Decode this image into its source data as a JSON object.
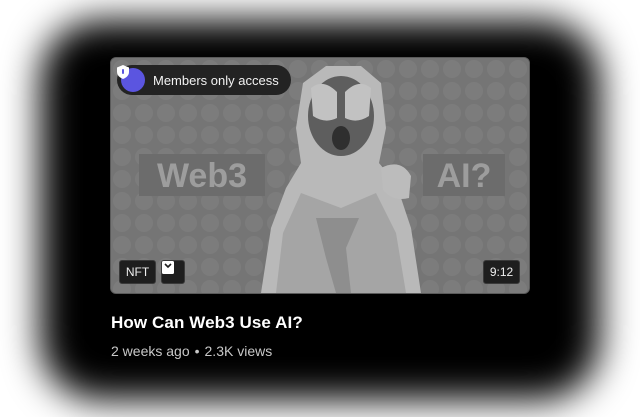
{
  "video": {
    "members_badge": "Members only access",
    "thumbnail_text_left": "Web3",
    "thumbnail_text_right": "AI?",
    "tag_label": "NFT",
    "duration": "9:12",
    "title": "How Can Web3 Use AI?",
    "age": "2 weeks ago",
    "separator": "•",
    "views": "2.3K views"
  },
  "icons": {
    "badge_icon": "shield-lock-icon",
    "tag_icon": "bookmark-icon"
  },
  "colors": {
    "badge_accent": "#5b55e0",
    "background": "#000000"
  }
}
